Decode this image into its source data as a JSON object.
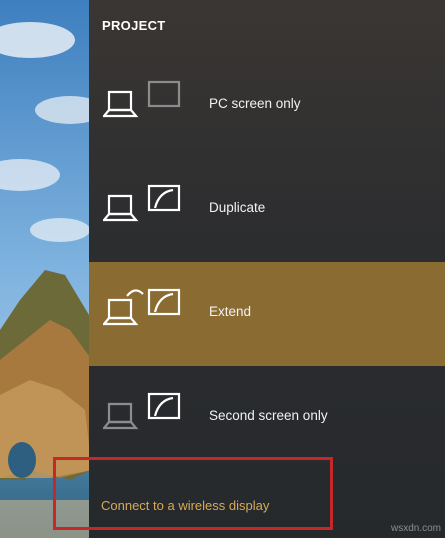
{
  "panel": {
    "title": "PROJECT",
    "options": [
      {
        "label": "PC screen only",
        "icon": "pc-screen-only-icon",
        "selected": false
      },
      {
        "label": "Duplicate",
        "icon": "duplicate-icon",
        "selected": false
      },
      {
        "label": "Extend",
        "icon": "extend-icon",
        "selected": true
      },
      {
        "label": "Second screen only",
        "icon": "second-screen-only-icon",
        "selected": false
      }
    ],
    "wireless_link": "Connect to a wireless display"
  },
  "watermark": "wsxdn.com",
  "colors": {
    "selected_background": "#8a6b32",
    "link": "#d7a957",
    "annotation_box": "#c62828"
  }
}
